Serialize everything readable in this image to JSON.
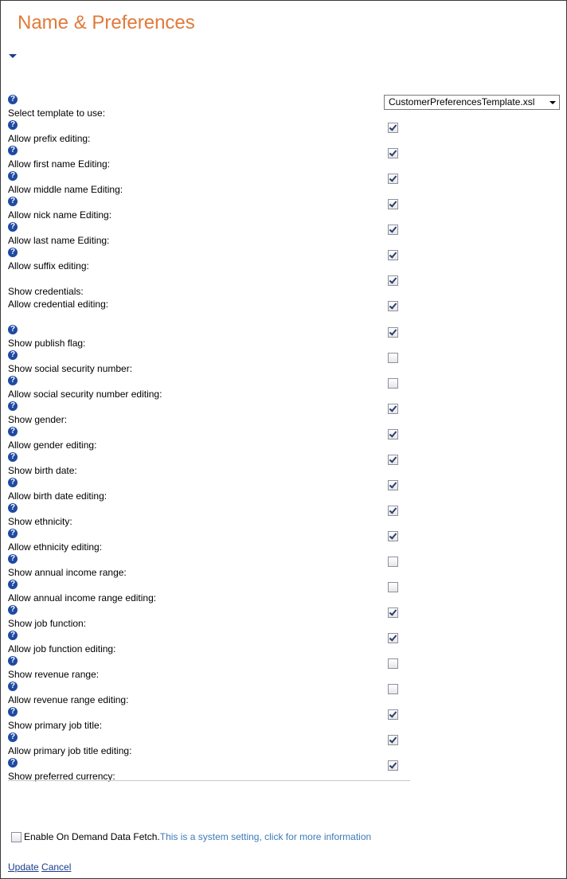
{
  "page": {
    "title": "Name & Preferences"
  },
  "template_select": {
    "label": "Select template to use:",
    "value": "CustomerPreferencesTemplate.xsl"
  },
  "help_icon": {
    "glyph": "?",
    "color": "#1f4aa3"
  },
  "settings": [
    {
      "label": "Allow prefix editing:",
      "checked": true,
      "help": true
    },
    {
      "label": "Allow first name Editing:",
      "checked": true,
      "help": true
    },
    {
      "label": "Allow middle name Editing:",
      "checked": true,
      "help": true
    },
    {
      "label": "Allow nick name Editing:",
      "checked": true,
      "help": true
    },
    {
      "label": "Allow last name Editing:",
      "checked": true,
      "help": true
    },
    {
      "label": "Allow suffix editing:",
      "checked": true,
      "help": true
    },
    {
      "label": "Show credentials:",
      "checked": true,
      "help": false
    },
    {
      "label": "Allow credential editing:",
      "checked": true,
      "help": false
    },
    {
      "label": "Show publish flag:",
      "checked": true,
      "help": true
    },
    {
      "label": "Show social security number:",
      "checked": false,
      "help": true
    },
    {
      "label": "Allow social security number editing:",
      "checked": false,
      "help": true
    },
    {
      "label": "Show gender:",
      "checked": true,
      "help": true
    },
    {
      "label": "Allow gender editing:",
      "checked": true,
      "help": true
    },
    {
      "label": "Show birth date:",
      "checked": true,
      "help": true
    },
    {
      "label": "Allow birth date editing:",
      "checked": true,
      "help": true
    },
    {
      "label": "Show ethnicity:",
      "checked": true,
      "help": true
    },
    {
      "label": "Allow ethnicity editing:",
      "checked": true,
      "help": true
    },
    {
      "label": "Show annual income range:",
      "checked": false,
      "help": true
    },
    {
      "label": "Allow annual income range editing:",
      "checked": false,
      "help": true
    },
    {
      "label": "Show job function:",
      "checked": true,
      "help": true
    },
    {
      "label": "Allow job function editing:",
      "checked": true,
      "help": true
    },
    {
      "label": "Show revenue range:",
      "checked": false,
      "help": true
    },
    {
      "label": "Allow revenue range editing:",
      "checked": false,
      "help": true
    },
    {
      "label": "Show primary job title:",
      "checked": true,
      "help": true
    },
    {
      "label": "Allow primary job title editing:",
      "checked": true,
      "help": true
    },
    {
      "label": "Show preferred currency:",
      "checked": true,
      "help": true
    }
  ],
  "on_demand": {
    "checked": false,
    "label": "Enable On Demand Data Fetch.",
    "info_link": "This is a system setting, click for more information"
  },
  "actions": {
    "update": "Update",
    "cancel": "Cancel"
  },
  "colors": {
    "title": "#e07a3a",
    "link": "#1a3b8c",
    "info_link": "#3d7ab8"
  }
}
